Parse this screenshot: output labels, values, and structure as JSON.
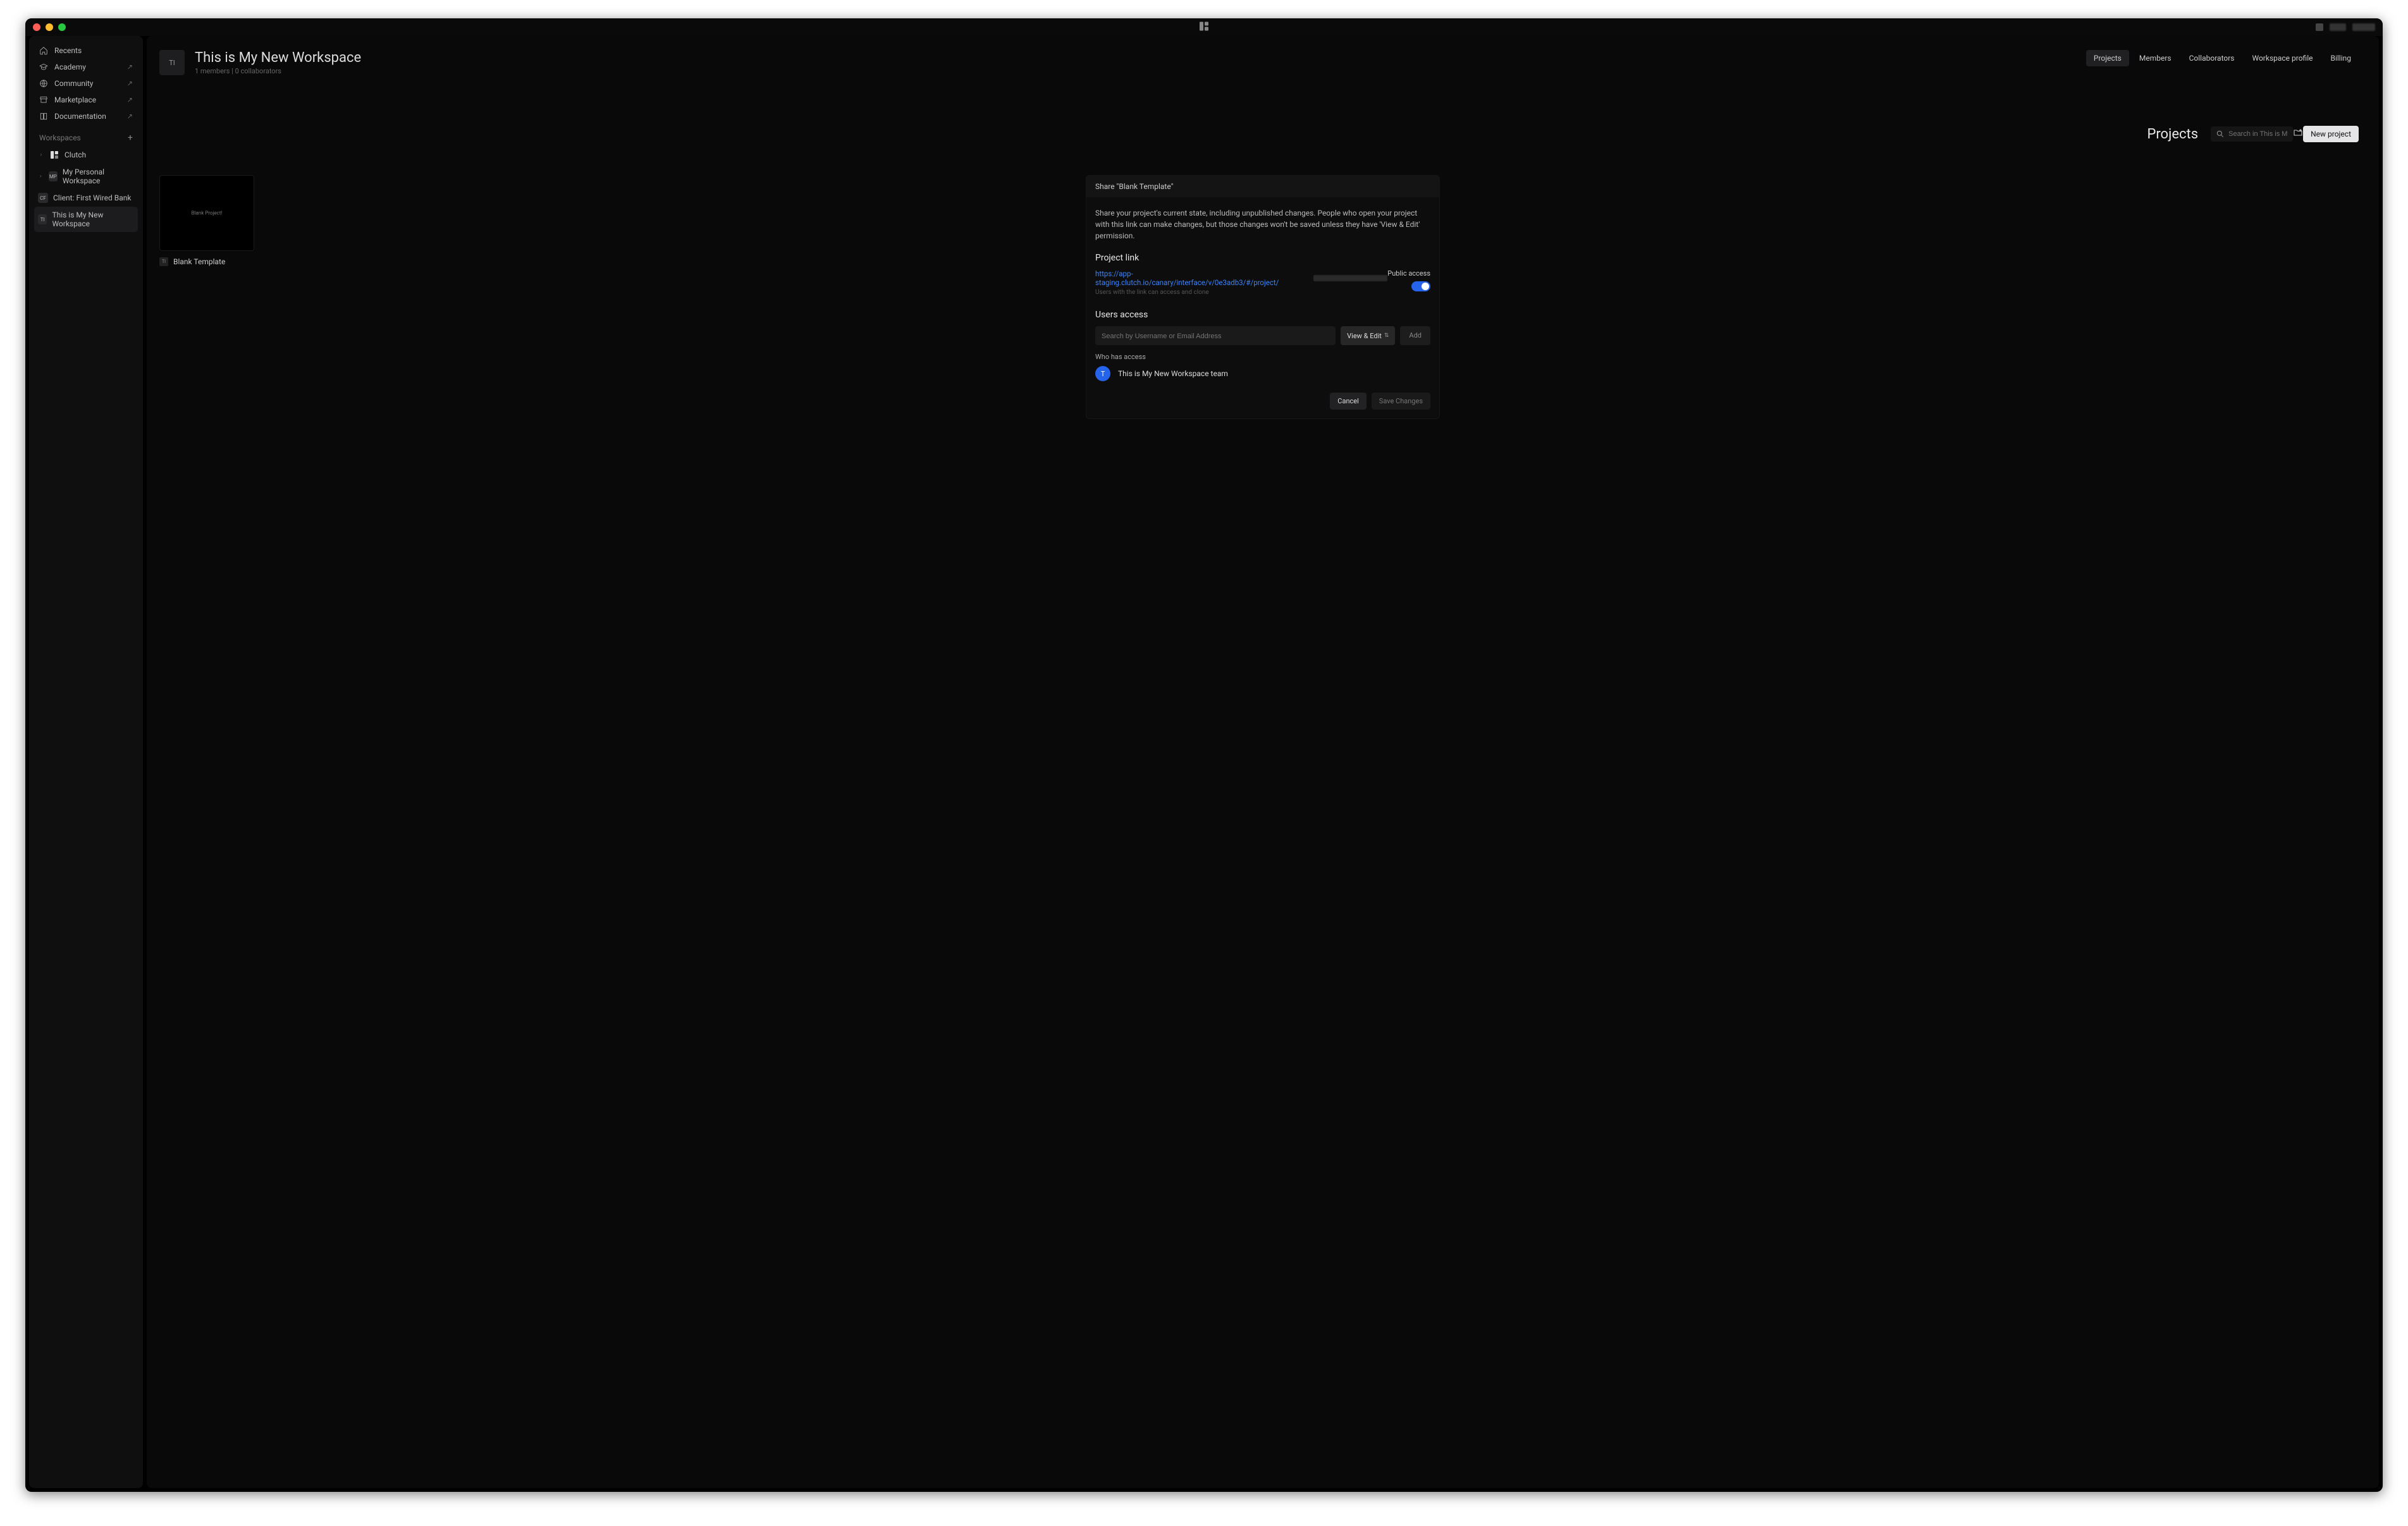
{
  "sidebar": {
    "nav": [
      {
        "label": "Recents",
        "icon": "home",
        "external": false
      },
      {
        "label": "Academy",
        "icon": "cap",
        "external": true
      },
      {
        "label": "Community",
        "icon": "globe",
        "external": true
      },
      {
        "label": "Marketplace",
        "icon": "store",
        "external": true
      },
      {
        "label": "Documentation",
        "icon": "book",
        "external": true
      }
    ],
    "workspaces_label": "Workspaces",
    "workspaces": [
      {
        "badge": "clutch",
        "badge_text": "",
        "label": "Clutch",
        "chevron": true
      },
      {
        "badge": "mp",
        "badge_text": "MP",
        "label": "My Personal Workspace",
        "chevron": true
      },
      {
        "badge": "cf",
        "badge_text": "CF",
        "label": "Client: First Wired Bank",
        "chevron": false
      },
      {
        "badge": "ti",
        "badge_text": "TI",
        "label": "This is My New Workspace",
        "chevron": false,
        "selected": true
      }
    ]
  },
  "header": {
    "avatar": "TI",
    "title": "This is My New Workspace",
    "meta": "1 members | 0 collaborators",
    "tabs": [
      {
        "label": "Projects",
        "active": true
      },
      {
        "label": "Members"
      },
      {
        "label": "Collaborators"
      },
      {
        "label": "Workspace profile"
      },
      {
        "label": "Billing"
      }
    ]
  },
  "projects": {
    "heading": "Projects",
    "search_placeholder": "Search in This is My Ne",
    "new_project": "New project",
    "card": {
      "thumb_label": "Blank Project!",
      "badge": "TI",
      "name": "Blank Template"
    }
  },
  "modal": {
    "title": "Share \"Blank Template\"",
    "description": "Share your project's current state, including unpublished changes. People who open your project with this link can make changes, but those changes won't be saved unless they have 'View & Edit' permission.",
    "project_link_label": "Project link",
    "link_visible": "https://app-staging.clutch.io/canary/interface/v/0e3adb3/#/project/",
    "link_help": "Users with the link can access and clone",
    "public_access_label": "Public access",
    "public_access_on": true,
    "users_access_label": "Users access",
    "user_search_placeholder": "Search by Username or Email Address",
    "role": "View & Edit",
    "add_label": "Add",
    "who_label": "Who has access",
    "who": {
      "initial": "T",
      "name": "This is My New Workspace team"
    },
    "cancel": "Cancel",
    "save": "Save Changes"
  }
}
